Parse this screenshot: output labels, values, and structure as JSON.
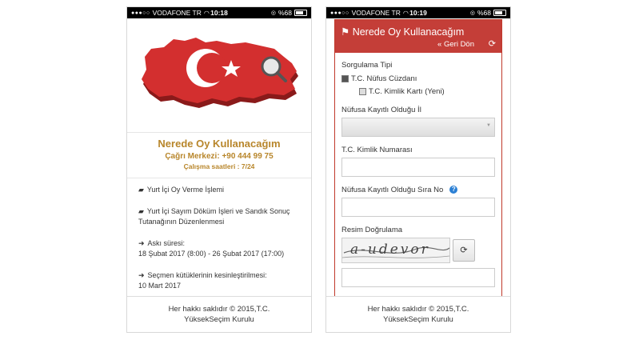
{
  "phone1": {
    "status": {
      "signal": "●●●○○",
      "carrier": "VODAFONE TR",
      "time": "10:18",
      "battery": "%68"
    },
    "brand": {
      "title": "Nerede Oy Kullanacağım",
      "call_center": "Çağrı Merkezi: +90 444 99 75",
      "hours": "Çalışma saatleri : 7/24"
    },
    "menu": [
      {
        "icon": "video-camera-icon",
        "text": "Yurt İçi Oy Verme İşlemi"
      },
      {
        "icon": "video-camera-icon",
        "text": "Yurt İçi Sayım Döküm İşleri ve Sandık Sonuç Tutanağının Düzenlenmesi"
      },
      {
        "icon": "arrow-circle-icon",
        "label": "Askı süresi:",
        "text": "18 Şubat 2017 (8:00) - 26 Şubat 2017 (17:00)"
      },
      {
        "icon": "arrow-circle-icon",
        "label": "Seçmen kütüklerinin kesinleştirilmesi:",
        "text": "10 Mart 2017"
      }
    ],
    "footer": {
      "line1": "Her hakkı saklıdır © 2015,T.C.",
      "line2": "YüksekSeçim Kurulu"
    }
  },
  "phone2": {
    "status": {
      "signal": "●●●○○",
      "carrier": "VODAFONE TR",
      "time": "10:19",
      "battery": "%68"
    },
    "header": {
      "title": "Nerede Oy Kullanacağım",
      "back": "Geri Dön"
    },
    "form": {
      "query_type_label": "Sorgulama Tipi",
      "option_1": "T.C. Nüfus Cüzdanı",
      "option_2": "T.C. Kimlik Kartı (Yeni)",
      "province_label": "Nüfusa Kayıtlı Olduğu İl",
      "tc_label": "T.C. Kimlik Numarası",
      "seq_label": "Nüfusa Kayıtlı Olduğu Sıra No",
      "captcha_label": "Resim Doğrulama",
      "captcha_text": "a-udevor"
    },
    "footer": {
      "line1": "Her hakkı saklıdır © 2015,T.C.",
      "line2": "YüksekSeçim Kurulu"
    }
  },
  "colors": {
    "brand_gold": "#b8862b",
    "header_red": "#c43e38",
    "flag_red": "#d32f2f"
  }
}
